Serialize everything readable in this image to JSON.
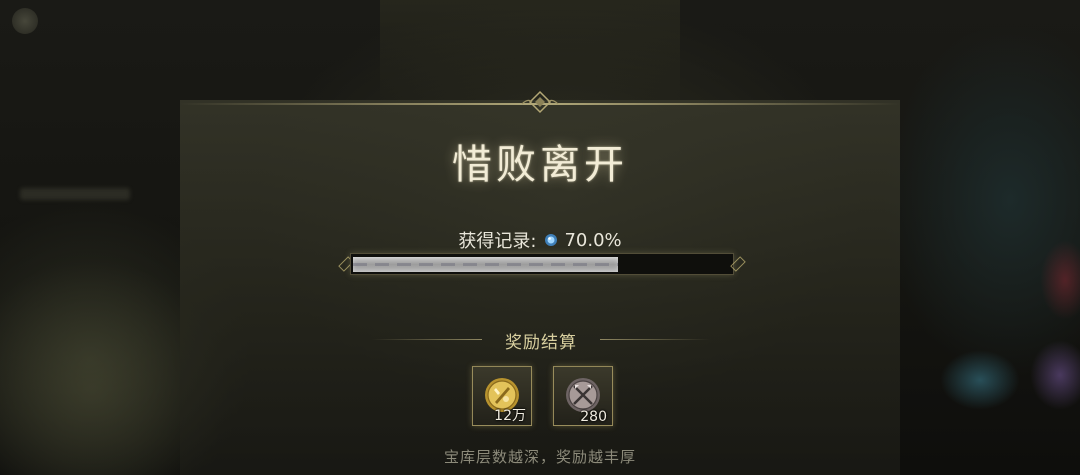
{
  "dialog": {
    "title": "惜败离开",
    "record_label": "获得记录:",
    "record_value": "70.0%",
    "progress_fraction": 0.7,
    "section_title": "奖励结算",
    "footer_hint": "宝库层数越深，奖励越丰厚"
  },
  "rewards": [
    {
      "icon": "gold-coin-icon",
      "count": "12万"
    },
    {
      "icon": "silver-crossed-swords-icon",
      "count": "280"
    }
  ],
  "colors": {
    "title": "#f2ecd6",
    "accent_gold": "#d8cf9f",
    "progress_fill": "#b8b8b8",
    "hint_text": "#8c8a7a"
  }
}
